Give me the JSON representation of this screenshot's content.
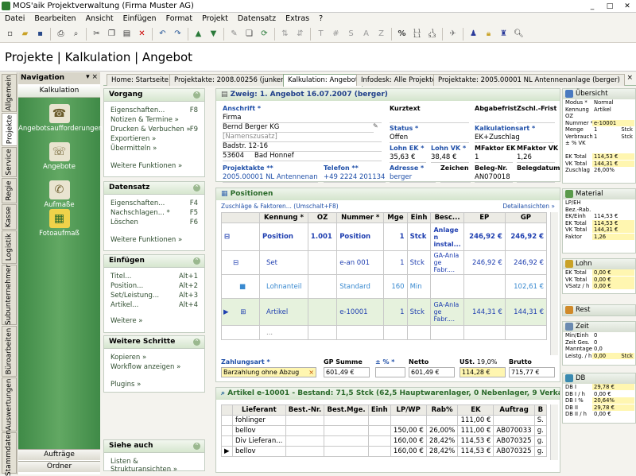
{
  "window": {
    "title": "MOS'aik Projektverwaltung (Firma Muster AG)"
  },
  "menu": [
    "Datei",
    "Bearbeiten",
    "Ansicht",
    "Einfügen",
    "Format",
    "Projekt",
    "Datensatz",
    "Extras",
    "?"
  ],
  "toolbar": {
    "buttons": [
      "new-icon",
      "open-icon",
      "save-icon",
      "print-icon",
      "print-preview-icon",
      "cut-icon",
      "copy-icon",
      "paste-icon",
      "delete-icon",
      "undo-icon",
      "redo-icon",
      "move-up-icon",
      "move-down-icon",
      "edit-icon",
      "copy-doc-icon",
      "refresh-icon",
      "sort-icon",
      "sort-desc-icon",
      "text-t-icon",
      "hash-icon",
      "text-s-icon",
      "text-a-icon",
      "text-z-icon",
      "percent-icon",
      "numbers-icon",
      "decimal-icon",
      "tools-icon",
      "user-icon",
      "lock-icon",
      "user-lock-icon",
      "search-doc-icon"
    ],
    "text_glyphs": {
      "percent": "%",
      "t": "T",
      "hash": "#",
      "s": "S",
      "a": "A",
      "z": "Z",
      "numbers": "1,1\n1,1",
      "decimal": ",1\n5,3"
    }
  },
  "header": {
    "title": "Projekte | Kalkulation | Angebot"
  },
  "vtabs": [
    "Allgemein",
    "Projekte",
    "Service",
    "Regie",
    "Kasse",
    "Logistik",
    "Subunternehmer",
    "Büroarbeiten",
    "Auswertungen",
    "Stammdaten"
  ],
  "navigation": {
    "title": "Navigation",
    "pin": "▾ ×",
    "section": "Kalkulation",
    "items": [
      {
        "label": "Angebotsaufforderungen",
        "icon": "inquiry-icon"
      },
      {
        "label": "Angebote",
        "icon": "offer-icon"
      },
      {
        "label": "Aufmaße",
        "icon": "measurement-icon"
      },
      {
        "label": "Fotoaufmaß",
        "icon": "photo-measurement-icon"
      }
    ],
    "bottom": [
      "Aufträge",
      "Ordner"
    ]
  },
  "tabs": [
    "Home: Startseite",
    "Projektakte: 2008.00256 (junkers)",
    "Kalkulation: Angebot",
    "Infodesk: Alle Projekte",
    "Projektakte: 2005.00001 NL Antennenanlage (berger)"
  ],
  "tabs_close": "×",
  "actions": {
    "vorgang": {
      "title": "Vorgang",
      "items": [
        {
          "label": "Eigenschaften...",
          "key": "F8"
        },
        {
          "label": "Notizen & Termine »",
          "key": ""
        },
        {
          "label": "Drucken & Verbuchen »",
          "key": "F9"
        },
        {
          "label": "Exportieren »",
          "key": ""
        },
        {
          "label": "Übermitteln »",
          "key": ""
        }
      ],
      "more": "Weitere Funktionen »"
    },
    "datensatz": {
      "title": "Datensatz",
      "items": [
        {
          "label": "Eigenschaften...",
          "key": "F4"
        },
        {
          "label": "Nachschlagen... *",
          "key": "F5"
        },
        {
          "label": "Löschen",
          "key": "F6"
        }
      ],
      "more": "Weitere Funktionen »"
    },
    "einfuegen": {
      "title": "Einfügen",
      "items": [
        {
          "label": "Titel...",
          "key": "Alt+1"
        },
        {
          "label": "Position...",
          "key": "Alt+2"
        },
        {
          "label": "Set/Leistung...",
          "key": "Alt+3"
        },
        {
          "label": "Artikel...",
          "key": "Alt+4"
        }
      ],
      "more": "Weitere »"
    },
    "weitere": {
      "title": "Weitere Schritte",
      "items": [
        {
          "label": "Kopieren »",
          "key": ""
        },
        {
          "label": "Workflow anzeigen »",
          "key": ""
        }
      ],
      "more": "Plugins »"
    },
    "siehe": {
      "title": "Siehe auch",
      "items": [
        {
          "label": "Listen & Strukturansichten »",
          "key": ""
        }
      ]
    }
  },
  "angebot": {
    "title": "Zweig: 1. Angebot 16.07.2007 (berger)",
    "anschrift_label": "Anschrift *",
    "anschrift": [
      "Firma",
      "Bernd Berger KG",
      "[Namenszusatz]",
      "Badstr. 12-16"
    ],
    "plz": "53604",
    "ort": "Bad Honnef",
    "kurztext_label": "Kurztext",
    "abgabefrist_label": "Abgabefrist",
    "zschl_label": "Zschl.-Frist",
    "status_label": "Status *",
    "status": "Offen",
    "kalkart_label": "Kalkulationsart *",
    "kalkart": "EK+Zuschlag",
    "lohnek_label": "Lohn EK *",
    "lohnek": "35,63 €",
    "lohnvk_label": "Lohn VK *",
    "lohnvk": "38,48 €",
    "mfek_label": "MFaktor EK",
    "mfek": "1",
    "mfvk_label": "MFaktor VK",
    "mfvk": "1,26",
    "projektakte_label": "Projektakte **",
    "projektakte": "2005.00001 NL Antennenanlage",
    "telefon_label": "Telefon **",
    "telefon": "+49 2224 2011345",
    "adresse_label": "Adresse *",
    "adresse": "berger",
    "zeichen_label": "Zeichen",
    "belegnr_label": "Beleg-Nr.",
    "belegnr": "AN070018",
    "belegdatum_label": "Belegdatum"
  },
  "positionen": {
    "title": "Positionen",
    "link": "Zuschläge & Faktoren... (Umschalt+F8)",
    "detail": "Detailansichten »",
    "columns": [
      "Kennung *",
      "OZ",
      "Nummer *",
      "Mge",
      "Einh",
      "Besc...",
      "EP",
      "GP"
    ],
    "rows": [
      {
        "kennung": "Position",
        "oz": "1.001",
        "nummer": "Position",
        "mge": "1",
        "einh": "Stck",
        "besc": "Anlage n instal...",
        "ep": "246,92 €",
        "gp": "246,92 €"
      },
      {
        "kennung": "Set",
        "oz": "",
        "nummer": "e-an 001",
        "mge": "1",
        "einh": "Stck",
        "besc": "GA-Anla ge Fabr....",
        "ep": "246,92 €",
        "gp": "246,92 €"
      },
      {
        "kennung": "Lohnanteil",
        "oz": "",
        "nummer": "Standard",
        "mge": "160",
        "einh": "Min",
        "besc": "",
        "ep": "",
        "gp": "102,61 €"
      },
      {
        "kennung": "Artikel",
        "oz": "",
        "nummer": "e-10001",
        "mge": "1",
        "einh": "Stck",
        "besc": "GA-Anla ge Fabr....",
        "ep": "144,31 €",
        "gp": "144,31 €"
      },
      {
        "kennung": "...",
        "oz": "",
        "nummer": "",
        "mge": "",
        "einh": "",
        "besc": "",
        "ep": "",
        "gp": ""
      }
    ],
    "footer": {
      "zahlungsart_label": "Zahlungsart *",
      "zahlungsart": "Barzahlung ohne Abzug",
      "gpsumme_label": "GP Summe",
      "gpsumme": "601,49 €",
      "pct_label": "± % *",
      "netto_label": "Netto",
      "netto": "601,49 €",
      "ust_label": "USt.",
      "ust_pct": "19,0%",
      "ust": "114,28 €",
      "brutto_label": "Brutto",
      "brutto": "715,77 €"
    }
  },
  "artikel": {
    "title": "Artikel e-10001 - Bestand: 71,5 Stck (62,5 Hauptwarenlager, 0 Nebenlager, 9 Verkaufsfra...",
    "columns": [
      "Lieferant",
      "Best.-Nr.",
      "Best.Mge.",
      "Einh",
      "LP/WP",
      "Rab%",
      "EK",
      "Auftrag",
      "B"
    ],
    "rows": [
      {
        "lieferant": "fohlinger",
        "bestnr": "",
        "bestmge": "",
        "einh": "",
        "lpwp": "",
        "rab": "",
        "ek": "111,00 €",
        "auftrag": "",
        "b": "S."
      },
      {
        "lieferant": "bellov",
        "bestnr": "",
        "bestmge": "",
        "einh": "",
        "lpwp": "150,00 €",
        "rab": "26,00%",
        "ek": "111,00 €",
        "auftrag": "AB070033",
        "b": "g."
      },
      {
        "lieferant": "Div Lieferan...",
        "bestnr": "",
        "bestmge": "",
        "einh": "",
        "lpwp": "160,00 €",
        "rab": "28,42%",
        "ek": "114,53 €",
        "auftrag": "AB070325",
        "b": "g."
      },
      {
        "lieferant": "bellov",
        "bestnr": "",
        "bestmge": "",
        "einh": "",
        "lpwp": "160,00 €",
        "rab": "28,42%",
        "ek": "114,53 €",
        "auftrag": "AB070325",
        "b": "g."
      }
    ]
  },
  "right": {
    "uebersicht": {
      "title": "Übersicht",
      "rows": [
        [
          "Modus *",
          "Normal",
          ""
        ],
        [
          "Kennung",
          "Artikel",
          ""
        ],
        [
          "OZ",
          "",
          ""
        ],
        [
          "Nummer *",
          "e-10001",
          ""
        ],
        [
          "Menge",
          "1",
          "Stck"
        ],
        [
          "Verbrauch",
          "1",
          "Stck"
        ],
        [
          "± % VK",
          "",
          ""
        ],
        [
          "",
          "",
          ""
        ],
        [
          "EK Total",
          "114,53 €",
          ""
        ],
        [
          "VK Total",
          "144,31 €",
          ""
        ],
        [
          "Zuschlag",
          "26,00%",
          ""
        ]
      ]
    },
    "material": {
      "title": "Material",
      "rows": [
        [
          "LP/EH",
          "",
          ""
        ],
        [
          "Bez.-Rab.",
          "",
          ""
        ],
        [
          "EK/Einh",
          "114,53 €",
          ""
        ],
        [
          "EK Total",
          "114,53 €",
          ""
        ],
        [
          "VK Total",
          "144,31 €",
          ""
        ],
        [
          "Faktor",
          "1,26",
          ""
        ]
      ]
    },
    "lohn": {
      "title": "Lohn",
      "rows": [
        [
          "EK Total",
          "0,00 €",
          ""
        ],
        [
          "VK Total",
          "0,00 €",
          ""
        ],
        [
          "VSatz / h",
          "0,00 €",
          ""
        ]
      ]
    },
    "rest": {
      "title": "Rest"
    },
    "zeit": {
      "title": "Zeit",
      "rows": [
        [
          "Min/Einh",
          "0",
          ""
        ],
        [
          "Zeit Ges.",
          "0",
          ""
        ],
        [
          "Manntage",
          "0,0",
          ""
        ],
        [
          "Leistg. / h",
          "0,00",
          "Stck"
        ]
      ]
    },
    "db": {
      "title": "DB",
      "rows": [
        [
          "DB I",
          "29,78 €",
          ""
        ],
        [
          "DB I / h",
          "0,00 €",
          ""
        ],
        [
          "DB I %",
          "20,64%",
          ""
        ],
        [
          "DB II",
          "29,78 €",
          ""
        ],
        [
          "DB II / h",
          "0,00 €",
          ""
        ]
      ]
    }
  }
}
